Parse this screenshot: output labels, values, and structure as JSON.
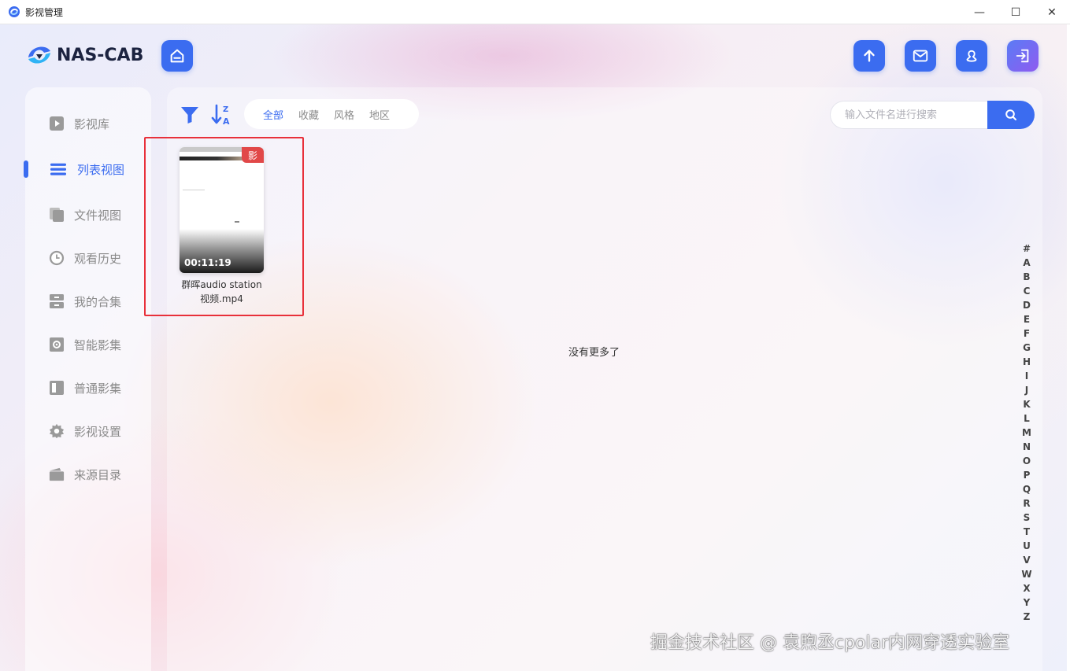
{
  "window": {
    "title": "影视管理",
    "controls": {
      "minimize": "—",
      "maximize": "☐",
      "close": "✕"
    }
  },
  "brand": {
    "name": "NAS-CAB",
    "accent": "#3b6cf0"
  },
  "header": {
    "buttons": [
      "home-icon",
      "upload-icon",
      "mail-icon",
      "user-icon",
      "logout-icon"
    ]
  },
  "sidebar": {
    "items": [
      {
        "label": "影视库",
        "icon": "play-icon"
      },
      {
        "label": "列表视图",
        "icon": "list-icon",
        "active": true
      },
      {
        "label": "文件视图",
        "icon": "copy-icon"
      },
      {
        "label": "观看历史",
        "icon": "clock-icon"
      },
      {
        "label": "我的合集",
        "icon": "drawer-icon"
      },
      {
        "label": "智能影集",
        "icon": "gear-box-icon"
      },
      {
        "label": "普通影集",
        "icon": "book-icon"
      },
      {
        "label": "影视设置",
        "icon": "gear-icon"
      },
      {
        "label": "来源目录",
        "icon": "folder-icon"
      }
    ]
  },
  "toolbar": {
    "tabs": [
      {
        "label": "全部",
        "active": true
      },
      {
        "label": "收藏"
      },
      {
        "label": "风格"
      },
      {
        "label": "地区"
      }
    ],
    "search": {
      "placeholder": "输入文件名进行搜索",
      "value": ""
    }
  },
  "media": [
    {
      "title": "群晖audio station视频.mp4",
      "duration": "00:11:19",
      "badge": "影"
    }
  ],
  "empty_message": "没有更多了",
  "alphabet": [
    "#",
    "A",
    "B",
    "C",
    "D",
    "E",
    "F",
    "G",
    "H",
    "I",
    "J",
    "K",
    "L",
    "M",
    "N",
    "O",
    "P",
    "Q",
    "R",
    "S",
    "T",
    "U",
    "V",
    "W",
    "X",
    "Y",
    "Z"
  ],
  "watermark": "掘金技术社区 @ 袁煦丞cpolar内网穿透实验室"
}
